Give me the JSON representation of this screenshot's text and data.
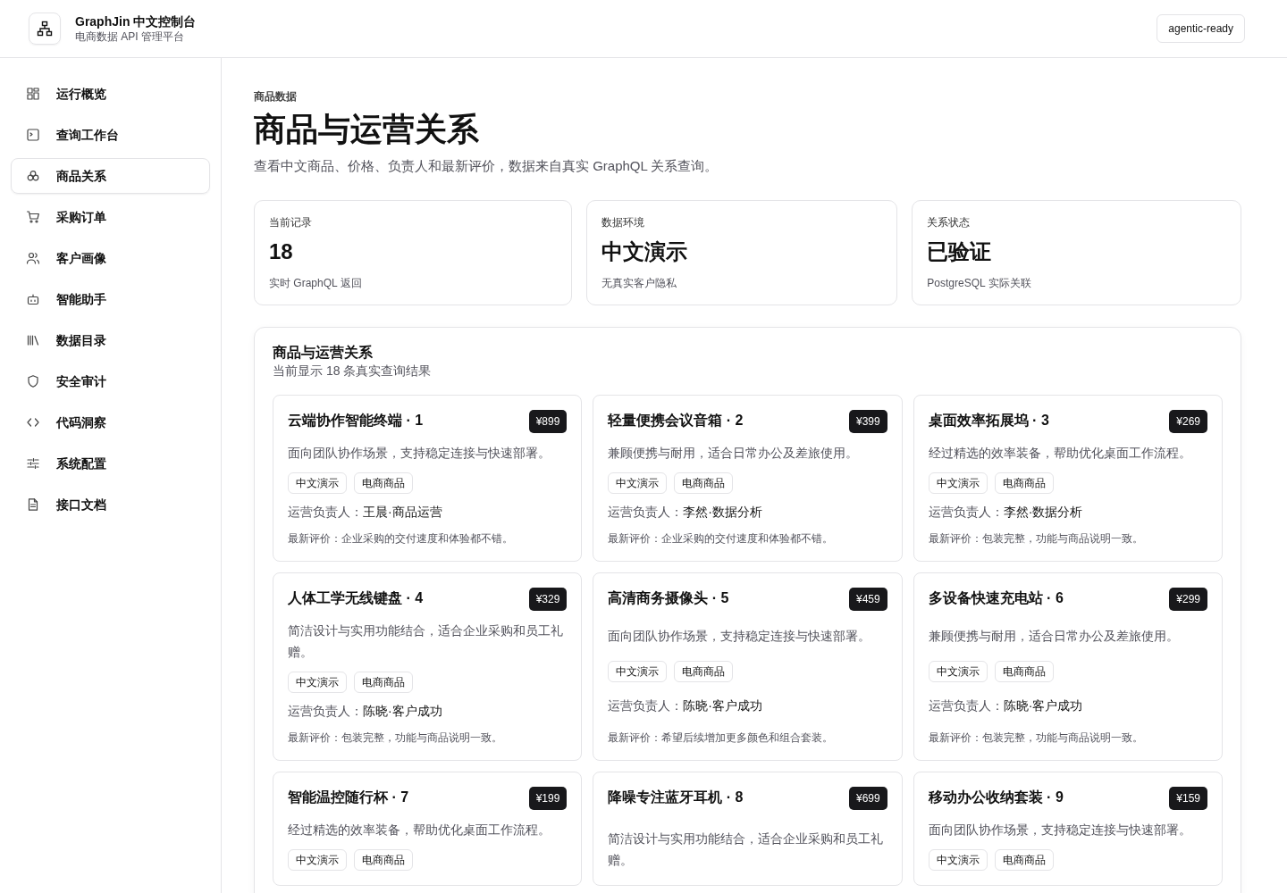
{
  "header": {
    "title": "GraphJin 中文控制台",
    "subtitle": "电商数据 API 管理平台",
    "badge": "agentic-ready"
  },
  "sidebar": {
    "items": [
      {
        "label": "运行概览",
        "selected": false
      },
      {
        "label": "查询工作台",
        "selected": false
      },
      {
        "label": "商品关系",
        "selected": true
      },
      {
        "label": "采购订单",
        "selected": false
      },
      {
        "label": "客户画像",
        "selected": false
      },
      {
        "label": "智能助手",
        "selected": false
      },
      {
        "label": "数据目录",
        "selected": false
      },
      {
        "label": "安全审计",
        "selected": false
      },
      {
        "label": "代码洞察",
        "selected": false
      },
      {
        "label": "系统配置",
        "selected": false
      },
      {
        "label": "接口文档",
        "selected": false
      }
    ]
  },
  "page": {
    "eyebrow": "商品数据",
    "title": "商品与运营关系",
    "description": "查看中文商品、价格、负责人和最新评价，数据来自真实 GraphQL 关系查询。"
  },
  "stats": [
    {
      "label": "当前记录",
      "value": "18",
      "note": "实时 GraphQL 返回"
    },
    {
      "label": "数据环境",
      "value": "中文演示",
      "note": "无真实客户隐私"
    },
    {
      "label": "关系状态",
      "value": "已验证",
      "note": "PostgreSQL 实际关联"
    }
  ],
  "panel": {
    "title": "商品与运营关系",
    "subtitle": "当前显示 18 条真实查询结果",
    "products": [
      {
        "name": "云端协作智能终端 · 1",
        "price": "¥899",
        "description": "面向团队协作场景，支持稳定连接与快速部署。",
        "tags": [
          "中文演示",
          "电商商品"
        ],
        "owner_label": "运营负责人：",
        "owner": "王晨·商品运营",
        "review": "最新评价：企业采购的交付速度和体验都不错。"
      },
      {
        "name": "轻量便携会议音箱 · 2",
        "price": "¥399",
        "description": "兼顾便携与耐用，适合日常办公及差旅使用。",
        "tags": [
          "中文演示",
          "电商商品"
        ],
        "owner_label": "运营负责人：",
        "owner": "李然·数据分析",
        "review": "最新评价：企业采购的交付速度和体验都不错。"
      },
      {
        "name": "桌面效率拓展坞 · 3",
        "price": "¥269",
        "description": "经过精选的效率装备，帮助优化桌面工作流程。",
        "tags": [
          "中文演示",
          "电商商品"
        ],
        "owner_label": "运营负责人：",
        "owner": "李然·数据分析",
        "review": "最新评价：包装完整，功能与商品说明一致。"
      },
      {
        "name": "人体工学无线键盘 · 4",
        "price": "¥329",
        "description": "简洁设计与实用功能结合，适合企业采购和员工礼赠。",
        "tags": [
          "中文演示",
          "电商商品"
        ],
        "owner_label": "运营负责人：",
        "owner": "陈晓·客户成功",
        "review": "最新评价：包装完整，功能与商品说明一致。"
      },
      {
        "name": "高清商务摄像头 · 5",
        "price": "¥459",
        "description": "面向团队协作场景，支持稳定连接与快速部署。",
        "tags": [
          "中文演示",
          "电商商品"
        ],
        "owner_label": "运营负责人：",
        "owner": "陈晓·客户成功",
        "review": "最新评价：希望后续增加更多颜色和组合套装。"
      },
      {
        "name": "多设备快速充电站 · 6",
        "price": "¥299",
        "description": "兼顾便携与耐用，适合日常办公及差旅使用。",
        "tags": [
          "中文演示",
          "电商商品"
        ],
        "owner_label": "运营负责人：",
        "owner": "陈晓·客户成功",
        "review": "最新评价：包装完整，功能与商品说明一致。"
      },
      {
        "name": "智能温控随行杯 · 7",
        "price": "¥199",
        "description": "经过精选的效率装备，帮助优化桌面工作流程。",
        "tags": [
          "中文演示",
          "电商商品"
        ]
      },
      {
        "name": "降噪专注蓝牙耳机 · 8",
        "price": "¥699",
        "description": "简洁设计与实用功能结合，适合企业采购和员工礼赠。"
      },
      {
        "name": "移动办公收纳套装 · 9",
        "price": "¥159",
        "description": "面向团队协作场景，支持稳定连接与快速部署。",
        "tags": [
          "中文演示",
          "电商商品"
        ]
      }
    ]
  }
}
